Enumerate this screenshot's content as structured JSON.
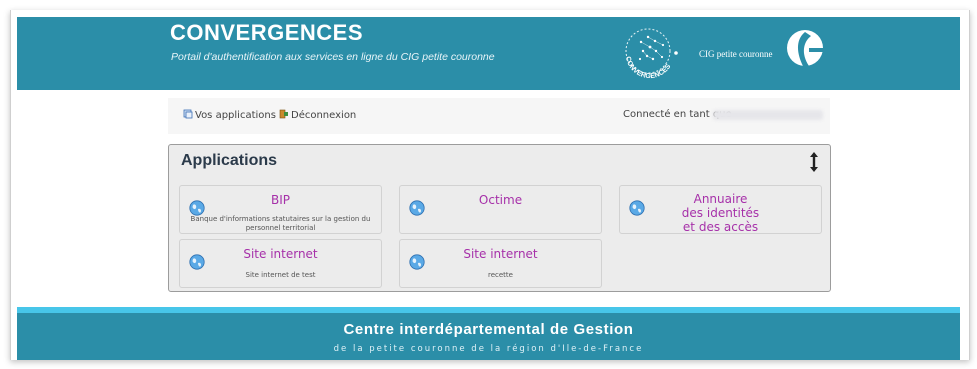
{
  "header": {
    "title": "CONVERGENCES",
    "subtitle": "Portail d'authentification aux services en ligne du CIG petite couronne",
    "logo_text": "CONVERGENCES",
    "org_name": "CIG petite couronne"
  },
  "toolbar": {
    "apps_label": "Vos applications",
    "logout_label": "Déconnexion",
    "connected_label": "Connecté en tant que"
  },
  "panel": {
    "title": "Applications",
    "cards": [
      {
        "title": "BIP",
        "desc": "Banque d'informations statutaires sur la gestion du personnel territorial"
      },
      {
        "title": "Octime",
        "desc": ""
      },
      {
        "title": "Annuaire des identités et des accès",
        "lines": [
          "Annuaire",
          "des identités",
          "et des accès"
        ],
        "desc": ""
      },
      {
        "title": "Site internet",
        "desc": "Site internet de test"
      },
      {
        "title": "Site internet",
        "desc": "recette"
      }
    ]
  },
  "footer": {
    "title": "Centre interdépartemental de Gestion",
    "subtitle": "de la petite couronne de la région d'Ile-de-France"
  },
  "colors": {
    "banner": "#2b8ea8",
    "accent_line": "#47c6e9",
    "link": "#a630a9"
  }
}
